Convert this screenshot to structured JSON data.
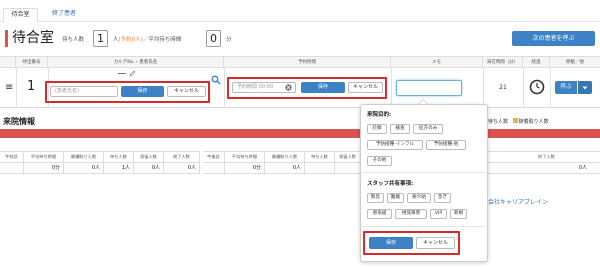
{
  "tabs": [
    {
      "label": "待合室",
      "active": true
    },
    {
      "label": "終了患者",
      "active": false
    }
  ],
  "header": {
    "title": "待合室",
    "waiting_label": "待ち人数",
    "waiting_count": "1",
    "unit_label": "人",
    "reserved_note": "(予約0人)",
    "avg_wait_label": "／平均待ち時間",
    "avg_wait_value": "0",
    "minutes_label": "分",
    "next_patient_button": "次の患者を呼ぶ"
  },
  "table": {
    "columns": [
      "呼出番号",
      "カルテNo.・患者氏名",
      "予約時間",
      "メモ",
      "滞在時間（分）",
      "経過",
      "移動／他"
    ],
    "row": {
      "menu_icon": "≡",
      "number": "1",
      "name_placeholder": "(患者氏名)",
      "name_save": "保存",
      "name_cancel": "キャンセル",
      "reservation_placeholder": "予約時間 00:00",
      "reservation_save": "保存",
      "reservation_cancel": "キャンセル",
      "memo_value": "",
      "stay_minutes": "21",
      "call_button": "呼ぶ"
    }
  },
  "visit_info": {
    "title": "来院情報",
    "legend": [
      {
        "label": "待ち人数",
        "color": "#d9534f"
      },
      {
        "label": "随着取り人数",
        "color": "#f0ad4e"
      }
    ],
    "stats_left": {
      "headers": [
        "午前診",
        "平均待ち時間",
        "最優取り人数",
        "待ち人数",
        "保留人数",
        "終了人数"
      ],
      "values": [
        "",
        "0分",
        "0人",
        "1人",
        "0人",
        "0人"
      ]
    },
    "stats_right": {
      "headers": [
        "午後診",
        "平均待ち時間",
        "最優取り人数",
        "待ち人数",
        "保留人数",
        "終了人数"
      ],
      "values": [
        "",
        "0分",
        "0人",
        "",
        "",
        "0人"
      ]
    },
    "footer_brand": "会社キャリアブレイン"
  },
  "popover": {
    "visit_purpose_title": "来院目的:",
    "purposes": [
      "診察",
      "検査",
      "処方のみ",
      "予防接種-インフル",
      "予防接種-他",
      "その他"
    ],
    "staff_title": "スタッフ共有事項:",
    "staff_tags": [
      "緊急",
      "難聴",
      "要介助",
      "急ぎ",
      "感染疑",
      "視覚障害",
      "VIP",
      "新規"
    ],
    "save": "保存",
    "cancel": "キャンセル"
  },
  "colors": {
    "accent": "#3c82c4",
    "alert": "#d9534f",
    "highlight_box": "#d62b2b"
  }
}
